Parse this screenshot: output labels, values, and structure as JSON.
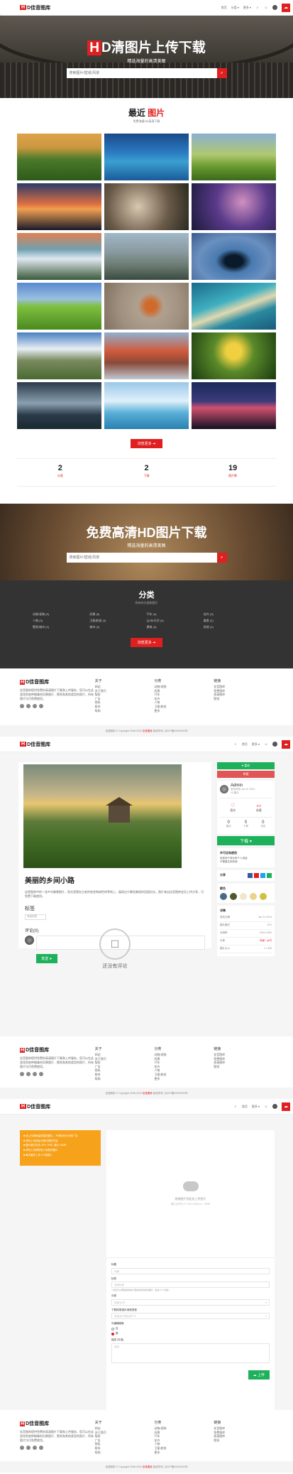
{
  "brand": {
    "hd": "H",
    "name": "D佳音图库"
  },
  "nav": {
    "home": "首页",
    "cats": "分类 ▾",
    "more": "更多 ▾",
    "search_icon": "search-icon",
    "upload_icon": "upload-icon"
  },
  "hero": {
    "hd": "H",
    "title": "D清图片上传下载",
    "subtitle": "精选海量的高清美图",
    "search_placeholder": "搜索图片/壁纸/风景"
  },
  "recent": {
    "title_a": "最近",
    "title_b": "图片",
    "subtitle": "免费海量HD高清下载",
    "more_button": "浏览更多 ➔"
  },
  "tiles": [
    {
      "name": "tile-farmhouse",
      "bg": "linear-gradient(180deg,#e0a24a 0%,#c9983f 30%,#4a7a2a 55%,#2e5a1a 100%)"
    },
    {
      "name": "tile-island",
      "bg": "linear-gradient(180deg,#1a4a8a 0%,#2a7ac0 40%,#3aa0d0 60%,#1a5a9a 100%)"
    },
    {
      "name": "tile-hills",
      "bg": "linear-gradient(180deg,#8ab0d0 0%,#b0c870 45%,#6a9a30 70%,#3a6a1a 100%)"
    },
    {
      "name": "tile-sunset",
      "bg": "linear-gradient(180deg,#2a3a6a 0%,#e07040 45%,#f0a050 55%,#1a1a2a 100%)"
    },
    {
      "name": "tile-mushrooms",
      "bg": "radial-gradient(circle at 40% 50%,#d8c8b0,#6a5a48 55%,#2a2a20 100%)"
    },
    {
      "name": "tile-tree-night",
      "bg": "radial-gradient(circle at 60% 40%,#d090c0,#5a3a8a 45%,#1a1a3a 100%)"
    },
    {
      "name": "tile-waterfall",
      "bg": "linear-gradient(180deg,#e08050 0%,#70a0b0 35%,#e0e8f0 55%,#3a5a3a 100%)"
    },
    {
      "name": "tile-cliffs",
      "bg": "linear-gradient(180deg,#a0b8c8 0%,#8a9aa0 40%,#6a7a70 70%,#3a4a40 100%)"
    },
    {
      "name": "tile-hole",
      "bg": "radial-gradient(ellipse at 50% 60%,#0a1a2a 0 15%,#4a7ab0 30%,#6a90c0 60%,#3a5a8a 100%)"
    },
    {
      "name": "tile-field",
      "bg": "linear-gradient(180deg,#5a8ad0 0%,#9ac0e0 35%,#80c040 50%,#4a8a20 100%)"
    },
    {
      "name": "tile-fox",
      "bg": "radial-gradient(circle at 55% 50%,#d06a2a 0 10%,#b0a090 25%,#a09080 60%,#807060 100%)"
    },
    {
      "name": "tile-sandbar",
      "bg": "linear-gradient(160deg,#1a6a8a 0%,#40b0c0 40%,#e0d8b0 55%,#2a8aa0 70%,#1a5a7a 100%)"
    },
    {
      "name": "tile-mountains",
      "bg": "linear-gradient(180deg,#4a80c0 0%,#e8eef5 35%,#7a8a60 60%,#4a6a30 100%)"
    },
    {
      "name": "tile-fly-geyser",
      "bg": "linear-gradient(180deg,#90b0d0 0%,#d05a3a 40%,#8a4a3a 65%,#c0c8d0 100%)"
    },
    {
      "name": "tile-macro-mushroom",
      "bg": "radial-gradient(circle at 50% 40%,#f0d040 0 15%,#5a8a2a 40%,#1a3a10 100%)"
    },
    {
      "name": "tile-lake-fog",
      "bg": "linear-gradient(180deg,#2a3a4a 0%,#8aa0b0 45%,#2a3a4a 70%,#1a2a30 100%)"
    },
    {
      "name": "tile-iceberg",
      "bg": "linear-gradient(180deg,#9ac8e8 0%,#e0f0fa 40%,#5ab0d8 65%,#2a80b0 100%)"
    },
    {
      "name": "tile-city-night",
      "bg": "linear-gradient(180deg,#1a2a5a 0%,#3a3a7a 40%,#d05070 55%,#101020 100%)"
    }
  ],
  "stats": [
    {
      "num": "2",
      "label": "分类"
    },
    {
      "num": "2",
      "label": "下载"
    },
    {
      "num": "19",
      "label": "图片数"
    }
  ],
  "hero2": {
    "title": "免费高清HD图片下载",
    "subtitle": "精选海量的高清美图",
    "search_placeholder": "搜索图片/壁纸/风景"
  },
  "categories": {
    "title": "分类",
    "subtitle": "所有的分类和图片",
    "items": [
      "动物/宠物 (5)",
      "风景 (6)",
      "汽车 (4)",
      "花卉 (3)",
      "人物 (3)",
      "卫星/航拍 (3)",
      "山/冰/天空 (3)",
      "美食 (2)",
      "壁纸/城市 (2)",
      "城市 (3)",
      "建筑 (3)",
      "其他 (1)"
    ],
    "more_button": "浏览更多 ➔"
  },
  "footer": {
    "brand_hd": "H",
    "brand_name": "D佳音图库",
    "about": "佳音图库提供免费的高清图片下载和上传服务，您可以在这里找到各种精美的风景图片、壁纸和其他类型的照片，所有图片均可免费使用。",
    "col1_title": "关于",
    "col1_items": [
      "网站",
      "关于我们",
      "版权",
      "广告",
      "隐私",
      "联系",
      "帮助"
    ],
    "col2_title": "分类",
    "col2_items": [
      "动物/宠物",
      "风景",
      "汽车",
      "花卉",
      "人物",
      "卫星/航拍",
      "更多"
    ],
    "col3_title": "链接",
    "col3_items": [
      "佳音图库",
      "免费图库",
      "高清图库",
      "壁纸"
    ],
    "copyright_a": "佳音图库 © Copyright 2008-2024",
    "copyright_b": "佳音图库",
    "copyright_c": "版权所有 | 京ICP备00000000号"
  },
  "detail": {
    "title": "美丽的乡间小路",
    "desc": "这是图库中的一张乡村美景图片，阳光洒落在古老的农舍和绿色的草地上，展现出宁静而美丽的田园风光。图片来自佳音图库会员上传分享，可免费下载使用。",
    "tags_label": "标签",
    "tag_placeholder": "添加标签",
    "comments_label": "评论(0)",
    "send_button": "发送 ➤",
    "no_comments": "还没有评论",
    "btn_like": "♥ 喜欢",
    "btn_report": "举报",
    "author_name": "Admin",
    "author_meta": "发布时间 Jan 01 2024",
    "author_meta2": "15 图片",
    "act_fav": "喜欢",
    "act_collect": "收藏",
    "num1": "0",
    "num1_l": "喜欢",
    "num2": "0",
    "num2_l": "下载",
    "num3": "0",
    "num3_l": "浏览",
    "download_button": "下载 ▾",
    "license_title": "许可证和使用",
    "license_1": "免费用于商业和个人用途",
    "license_2": "不需要注明来源",
    "share_label": "分享",
    "colors_title": "颜色",
    "colors": [
      "#4a6a8a",
      "#4e5a28",
      "#efe7c8",
      "#e9d48a",
      "#d0c040"
    ],
    "info_title": "详情",
    "info": [
      {
        "k": "发布日期",
        "v": "Jan 01 2024",
        "red": false
      },
      {
        "k": "图片格式",
        "v": "JPG",
        "red": false
      },
      {
        "k": "分辨率",
        "v": "1920×1080",
        "red": false
      },
      {
        "k": "分类",
        "v": "风景 / 乡村",
        "red": true
      },
      {
        "k": "图片大小",
        "v": "2.4 MB",
        "red": false
      }
    ]
  },
  "upload": {
    "rules": [
      "■ 请上传清晰高质量的图片，不得含有水印和广告",
      "■ 请勿上传违反法律法规的内容",
      "■ 图片格式支持 JPG, PNG, 最大 10MB",
      "■ 请勿上传侵犯他人版权的图片",
      "■ 每次最多上传 10 张图片"
    ],
    "drop_text": "拖拽图片到此处上传图片",
    "drop_sub": "图片必须大于 1920×1080 px, 10MB",
    "f_title": "标题",
    "f_title_ph": "标题",
    "f_tags": "标签",
    "f_tags_ph": "添加标签",
    "f_note": "* 标签可以帮助其他用户更快的找到您的图片（最多 5 个标签）",
    "f_cat": "分类",
    "f_cat_val": "风景/乡村",
    "f_sub": "下载权限/图片授权类型",
    "f_sub_val": "免费用于商业和个人",
    "f_flag": "可编辑图像",
    "r_no": "否",
    "r_yes": "是",
    "f_desc": "描述 (可选)",
    "f_desc_ph": "描述",
    "upload_button": "☁ 上传"
  }
}
